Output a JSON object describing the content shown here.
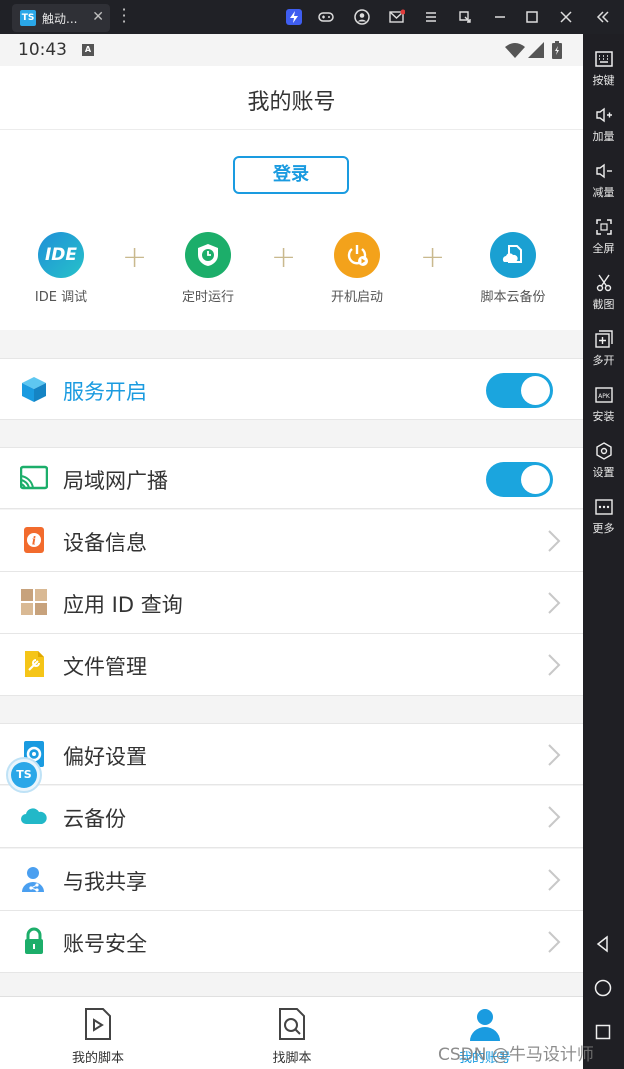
{
  "emulator": {
    "tab_title": "触动...",
    "tab_logo": "TS",
    "close_glyph": "✕",
    "toolbar_icons": [
      "bolt-icon",
      "gamepad-icon",
      "user-circle-icon",
      "mail-icon",
      "menu-icon",
      "popout-icon",
      "minimize-icon",
      "maximize-icon",
      "close-icon",
      "collapse-icon"
    ],
    "side_tools": [
      {
        "label": "按键",
        "icon": "keyboard-icon"
      },
      {
        "label": "加量",
        "icon": "volume-up-icon"
      },
      {
        "label": "减量",
        "icon": "volume-down-icon"
      },
      {
        "label": "全屏",
        "icon": "fullscreen-icon"
      },
      {
        "label": "截图",
        "icon": "scissors-icon"
      },
      {
        "label": "多开",
        "icon": "multi-open-icon"
      },
      {
        "label": "安装",
        "icon": "apk-install-icon"
      },
      {
        "label": "设置",
        "icon": "settings-icon"
      },
      {
        "label": "更多",
        "icon": "more-icon"
      }
    ],
    "nav_icons": [
      "back-icon",
      "home-icon",
      "recents-icon"
    ]
  },
  "status": {
    "time": "10:43",
    "badge": "A"
  },
  "header": {
    "title": "我的账号"
  },
  "login": {
    "label": "登录"
  },
  "features": [
    {
      "label": "IDE 调试",
      "icon_text": "IDE",
      "color": "#1f8fd8"
    },
    {
      "label": "定时运行",
      "color": "#1cae6a"
    },
    {
      "label": "开机启动",
      "color": "#f3a21b"
    },
    {
      "label": "脚本云备份",
      "color": "#1aa0d2"
    }
  ],
  "plus_glyph": "+",
  "service_row": {
    "label": "服务开启",
    "enabled": true
  },
  "group1": [
    {
      "label": "局域网广播",
      "type": "toggle",
      "enabled": true
    },
    {
      "label": "设备信息",
      "type": "link"
    },
    {
      "label": "应用 ID 查询",
      "type": "link"
    },
    {
      "label": "文件管理",
      "type": "link"
    }
  ],
  "group2": [
    {
      "label": "偏好设置"
    },
    {
      "label": "云备份"
    },
    {
      "label": "与我共享"
    },
    {
      "label": "账号安全"
    }
  ],
  "float_button": "TS",
  "bottom_nav": [
    {
      "label": "我的脚本",
      "active": false
    },
    {
      "label": "找脚本",
      "active": false
    },
    {
      "label": "我的账号",
      "active": true
    }
  ],
  "watermark": "CSDN @牛马设计师",
  "colors": {
    "accent": "#1a9be0",
    "toggle_on": "#1ba5de"
  }
}
